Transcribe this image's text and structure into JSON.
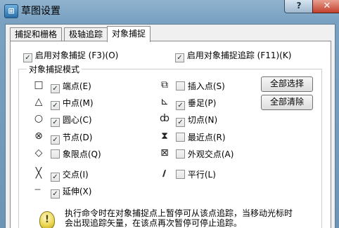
{
  "window": {
    "title": "草图设置",
    "help_label": "?",
    "close_label": "✕",
    "app_icon_glyph": "⊞"
  },
  "tabs": [
    {
      "label": "捕捉和栅格",
      "active": false
    },
    {
      "label": "极轴追踪",
      "active": false
    },
    {
      "label": "对象捕捉",
      "active": true
    }
  ],
  "top_options": {
    "enable_osnap": {
      "label": "启用对象捕捉 (F3)(O)",
      "checked": true
    },
    "enable_tracking": {
      "label": "启用对象捕捉追踪 (F11)(K)",
      "checked": true
    }
  },
  "group_title": "对象捕捉模式",
  "left_modes": [
    {
      "label": "端点(E)",
      "checked": true,
      "icon": "square-icon",
      "symbol": "□"
    },
    {
      "label": "中点(M)",
      "checked": true,
      "icon": "triangle-icon",
      "symbol": "△"
    },
    {
      "label": "圆心(C)",
      "checked": true,
      "icon": "circle-icon",
      "symbol": "○"
    },
    {
      "label": "节点(D)",
      "checked": true,
      "icon": "node-icon",
      "symbol": "⊗"
    },
    {
      "label": "象限点(Q)",
      "checked": false,
      "icon": "diamond-icon",
      "symbol": "◇"
    },
    {
      "label": "交点(I)",
      "checked": true,
      "icon": "cross-icon",
      "symbol": "╳"
    },
    {
      "label": "延伸(X)",
      "checked": true,
      "icon": "extension-icon",
      "symbol": "---"
    }
  ],
  "right_modes": [
    {
      "label": "插入点(S)",
      "checked": false,
      "icon": "insert-icon",
      "symbol": "⧉"
    },
    {
      "label": "垂足(P)",
      "checked": true,
      "icon": "perpendicular-icon",
      "symbol": "⊾"
    },
    {
      "label": "切点(N)",
      "checked": true,
      "icon": "tangent-icon",
      "symbol": "ȸ"
    },
    {
      "label": "最近点(R)",
      "checked": false,
      "icon": "nearest-icon",
      "symbol": "⧗"
    },
    {
      "label": "外观交点(A)",
      "checked": false,
      "icon": "apparent-intersection-icon",
      "symbol": "⊠"
    },
    {
      "label": "平行(L)",
      "checked": false,
      "icon": "parallel-icon",
      "symbol": "∕∕"
    }
  ],
  "buttons": {
    "select_all": "全部选择",
    "clear_all": "全部清除"
  },
  "note": {
    "line1": "执行命令时在对象捕捉点上暂停可从该点追踪，当移动光标时",
    "line2": "会出现追踪矢量，在该点再次暂停可停止追踪。",
    "icon_glyph": "!"
  },
  "colors": {
    "titlebar": "#7aa1c1",
    "close_button": "#c3412d"
  }
}
